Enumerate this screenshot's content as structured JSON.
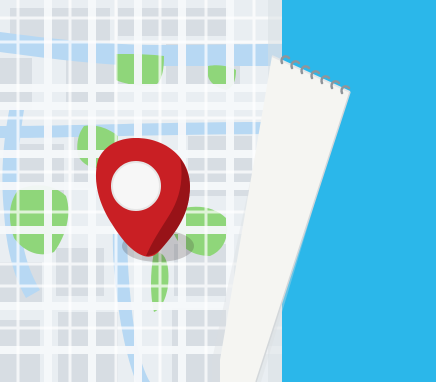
{
  "scene": {
    "colors": {
      "background_blue": "#2bb7ea",
      "map_base": "#e9eef2",
      "map_block": "#d7dde3",
      "map_road": "#f6f8fa",
      "water": "#b7d8f3",
      "park_green": "#8fd67a",
      "notebook_paper": "#f5f5f2",
      "notebook_shadow": "#d9dde0",
      "spiral": "#8f949a",
      "pin_red": "#c91f24",
      "pin_dark": "#8f1216",
      "pin_center": "#f7f7f7"
    },
    "icons": [
      "map-pin-icon",
      "spiral-notebook-icon",
      "city-map-icon"
    ]
  }
}
